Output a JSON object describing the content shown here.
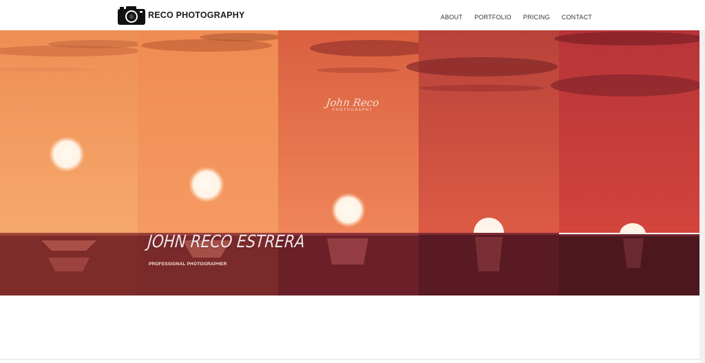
{
  "brand": {
    "name": "RECO PHOTOGRAPHY",
    "logo_icon": "camera-icon"
  },
  "nav": {
    "items": [
      {
        "label": "ABOUT"
      },
      {
        "label": "PORTFOLIO"
      },
      {
        "label": "PRICING"
      },
      {
        "label": "CONTACT"
      }
    ]
  },
  "hero": {
    "title": "JOHN RECO ESTRERA",
    "subtitle": "PROFESSIONAL PHOTOGRAPHER",
    "watermark": {
      "script": "John Reco",
      "sub": "PHOTOGRAPHY"
    },
    "panel_colors": [
      "#f09a5f",
      "#f28c58",
      "#ec7a52",
      "#d2483e",
      "#c9353a"
    ]
  }
}
